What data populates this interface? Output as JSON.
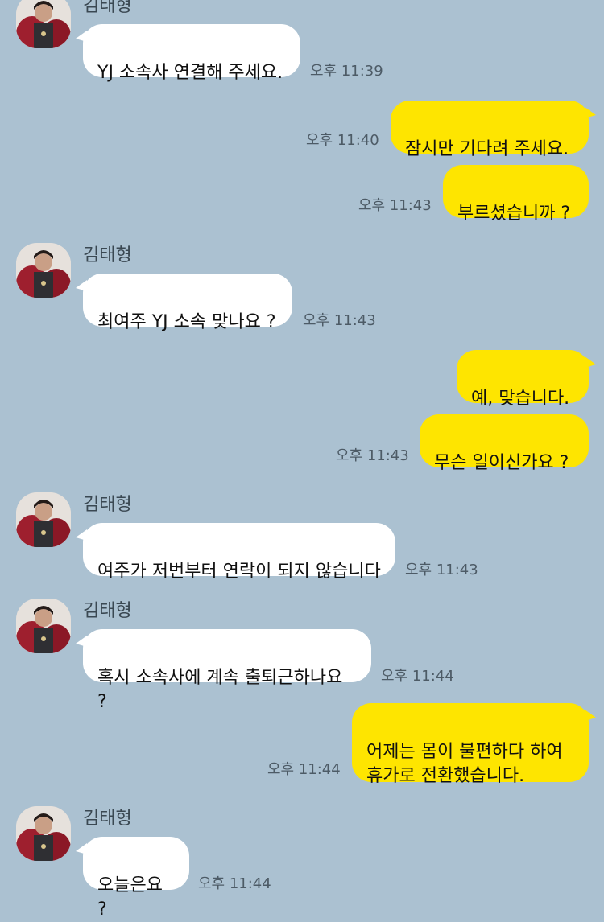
{
  "chat": {
    "sender_name": "김태형",
    "colors": {
      "background": "#abc1d1",
      "incoming_bubble": "#ffffff",
      "outgoing_bubble": "#fee500"
    },
    "messages": [
      {
        "dir": "in",
        "text": "YJ 소속사 연결해 주세요.",
        "time": "오후 11:39"
      },
      {
        "dir": "out",
        "text": "잠시만 기다려 주세요.",
        "time": "오후 11:40"
      },
      {
        "dir": "out",
        "text": "부르셨습니까 ?",
        "time": "오후 11:43"
      },
      {
        "dir": "in",
        "text": "최여주 YJ 소속 맞나요 ?",
        "time": "오후 11:43"
      },
      {
        "dir": "out",
        "text": "예, 맞습니다.",
        "time": ""
      },
      {
        "dir": "out",
        "text": "무슨 일이신가요 ?",
        "time": "오후 11:43"
      },
      {
        "dir": "in",
        "text": "여주가 저번부터 연락이 되지 않습니다",
        "time": "오후 11:43"
      },
      {
        "dir": "in",
        "text": "혹시 소속사에 계속 출퇴근하나요 ?",
        "time": "오후 11:44"
      },
      {
        "dir": "out",
        "text": "어제는 몸이 불편하다 하여\n휴가로 전환했습니다.",
        "time": "오후 11:44"
      },
      {
        "dir": "in",
        "text": "오늘은요 ?",
        "time": "오후 11:44"
      }
    ]
  }
}
